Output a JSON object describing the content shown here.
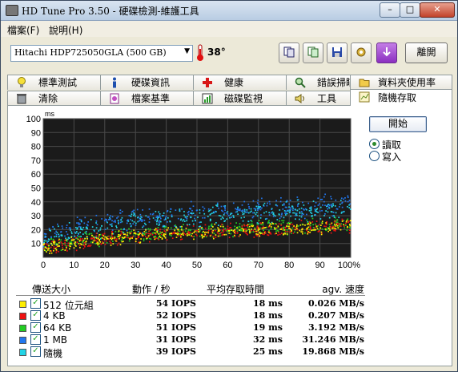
{
  "window": {
    "title": "HD Tune Pro 3.50 - 硬碟檢測-維護工具"
  },
  "menu": [
    "檔案(F)",
    "說明(H)"
  ],
  "toolbar": {
    "drive": "Hitachi HDP725050GLA (500 GB)",
    "temperature": "38°",
    "exit_label": "離開"
  },
  "tabs_row1": [
    {
      "label": "標準測試",
      "icon": "benchmark-icon"
    },
    {
      "label": "硬碟資訊",
      "icon": "info-icon"
    },
    {
      "label": "健康",
      "icon": "health-icon"
    },
    {
      "label": "錯誤掃瞄",
      "icon": "error-scan-icon"
    },
    {
      "label": "資料夾使用率",
      "icon": "folder-usage-icon"
    }
  ],
  "tabs_row2": [
    {
      "label": "清除",
      "icon": "erase-icon"
    },
    {
      "label": "檔案基準",
      "icon": "file-benchmark-icon"
    },
    {
      "label": "磁碟監視",
      "icon": "disk-monitor-icon"
    },
    {
      "label": "工具",
      "icon": "tools-icon"
    },
    {
      "label": "隨機存取",
      "icon": "random-access-icon"
    }
  ],
  "controls": {
    "start_label": "開始",
    "read_label": "讀取",
    "write_label": "寫入",
    "mode": "read"
  },
  "table": {
    "headers": [
      "傳送大小",
      "動作 / 秒",
      "平均存取時間",
      "agv. 速度"
    ],
    "rows": [
      {
        "label": "512 位元組",
        "color": "#ffee00",
        "iops": "54 IOPS",
        "access": "18 ms",
        "speed": "0.026 MB/s"
      },
      {
        "label": "4 KB",
        "color": "#ee1111",
        "iops": "52 IOPS",
        "access": "18 ms",
        "speed": "0.207 MB/s"
      },
      {
        "label": "64 KB",
        "color": "#22cc22",
        "iops": "51 IOPS",
        "access": "19 ms",
        "speed": "3.192 MB/s"
      },
      {
        "label": "1 MB",
        "color": "#2277ee",
        "iops": "31 IOPS",
        "access": "32 ms",
        "speed": "31.246 MB/s"
      },
      {
        "label": "隨機",
        "color": "#22d4e6",
        "iops": "39 IOPS",
        "access": "25 ms",
        "speed": "19.868 MB/s"
      }
    ]
  },
  "chart_data": {
    "type": "scatter",
    "ylabel": "ms",
    "xlim": [
      0,
      100
    ],
    "ylim": [
      0,
      100
    ],
    "x_ticks": [
      "0",
      "10",
      "20",
      "30",
      "40",
      "50",
      "60",
      "70",
      "80",
      "90",
      "100%"
    ],
    "y_ticks": [
      "10",
      "20",
      "30",
      "40",
      "50",
      "60",
      "70",
      "80",
      "90",
      "100"
    ],
    "grid": true,
    "series": [
      {
        "name": "512 位元組",
        "color": "#ffee00",
        "x": [
          0,
          10,
          20,
          30,
          40,
          50,
          60,
          70,
          80,
          90,
          100
        ],
        "y": [
          7,
          10,
          13,
          15,
          17,
          18,
          19,
          20,
          21,
          22,
          22
        ]
      },
      {
        "name": "4 KB",
        "color": "#ee1111",
        "x": [
          0,
          10,
          20,
          30,
          40,
          50,
          60,
          70,
          80,
          90,
          100
        ],
        "y": [
          7,
          10,
          13,
          15,
          17,
          18,
          19,
          20,
          21,
          22,
          23
        ]
      },
      {
        "name": "64 KB",
        "color": "#22cc22",
        "x": [
          0,
          10,
          20,
          30,
          40,
          50,
          60,
          70,
          80,
          90,
          100
        ],
        "y": [
          8,
          11,
          14,
          16,
          18,
          19,
          20,
          21,
          22,
          23,
          24
        ]
      },
      {
        "name": "1 MB",
        "color": "#2277ee",
        "x": [
          0,
          10,
          20,
          30,
          40,
          50,
          60,
          70,
          80,
          90,
          100
        ],
        "y": [
          16,
          22,
          26,
          28,
          30,
          32,
          34,
          35,
          36,
          37,
          38
        ]
      },
      {
        "name": "隨機",
        "color": "#22d4e6",
        "x": [
          0,
          10,
          20,
          30,
          40,
          50,
          60,
          70,
          80,
          90,
          100
        ],
        "y": [
          14,
          18,
          22,
          25,
          27,
          29,
          31,
          32,
          33,
          34,
          35
        ]
      }
    ]
  }
}
